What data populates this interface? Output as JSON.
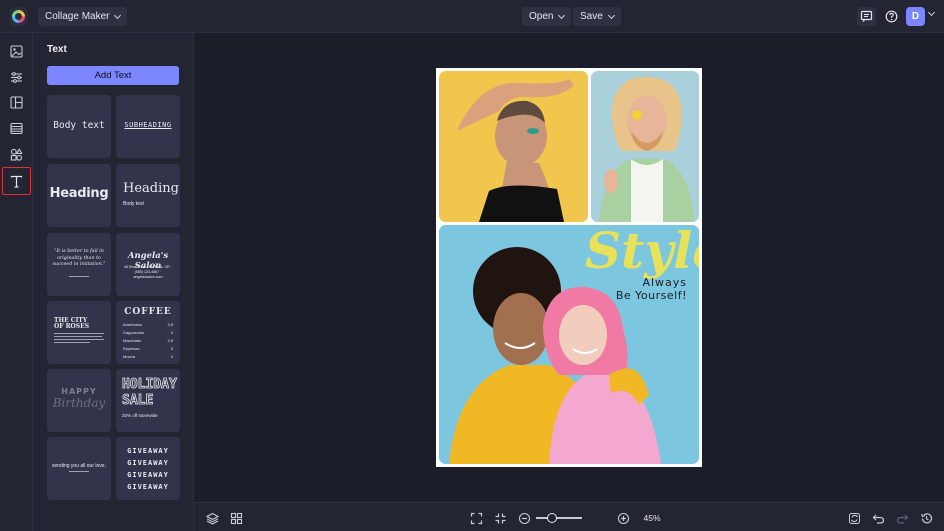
{
  "topbar": {
    "mode_label": "Collage Maker",
    "open_label": "Open",
    "save_label": "Save",
    "avatar_initial": "D"
  },
  "rail": {
    "items": [
      "image-icon",
      "sliders-icon",
      "layout-icon",
      "table-icon",
      "shapes-icon",
      "text-icon"
    ],
    "active": "text-icon"
  },
  "panel": {
    "title": "Text",
    "add_button": "Add Text",
    "presets": {
      "body_text": "Body text",
      "subheading": "SUBHEADING",
      "heading_bold": "Heading",
      "heading_serif": "Heading",
      "body_text_small": "Body text",
      "quote": "\"It is better to fail in originality than to succeed in imitation.\"",
      "salon_name": "Angela's Salon",
      "salon_details": "46 Elm Street · Portland, OR · (555) 123-4567 · angelassalon.com",
      "city_title_1": "THE CITY",
      "city_title_2": "OF ROSES",
      "coffee_title": "COFFEE",
      "coffee_items": [
        {
          "name": "Americano",
          "price": "3.5"
        },
        {
          "name": "Cappuccino",
          "price": "4"
        },
        {
          "name": "Macchiato",
          "price": "4.5"
        },
        {
          "name": "Espresso",
          "price": "3"
        },
        {
          "name": "Mocha",
          "price": "4"
        }
      ],
      "happy": "HAPPY",
      "birthday": "Birthday",
      "holiday": "HOLIDAY",
      "sale": "SALE",
      "sale_off": "20% off storewide",
      "sending_love": "sending you all our love,",
      "giveaway": "GIVEAWAY"
    }
  },
  "collage": {
    "overlay_script": "Style",
    "overlay_line1": "Always",
    "overlay_line2": "Be Yourself!"
  },
  "bottombar": {
    "zoom": "45%"
  },
  "colors": {
    "accent": "#7c86ff",
    "active_outline": "#e0313a",
    "script_yellow": "#e8e25a"
  }
}
